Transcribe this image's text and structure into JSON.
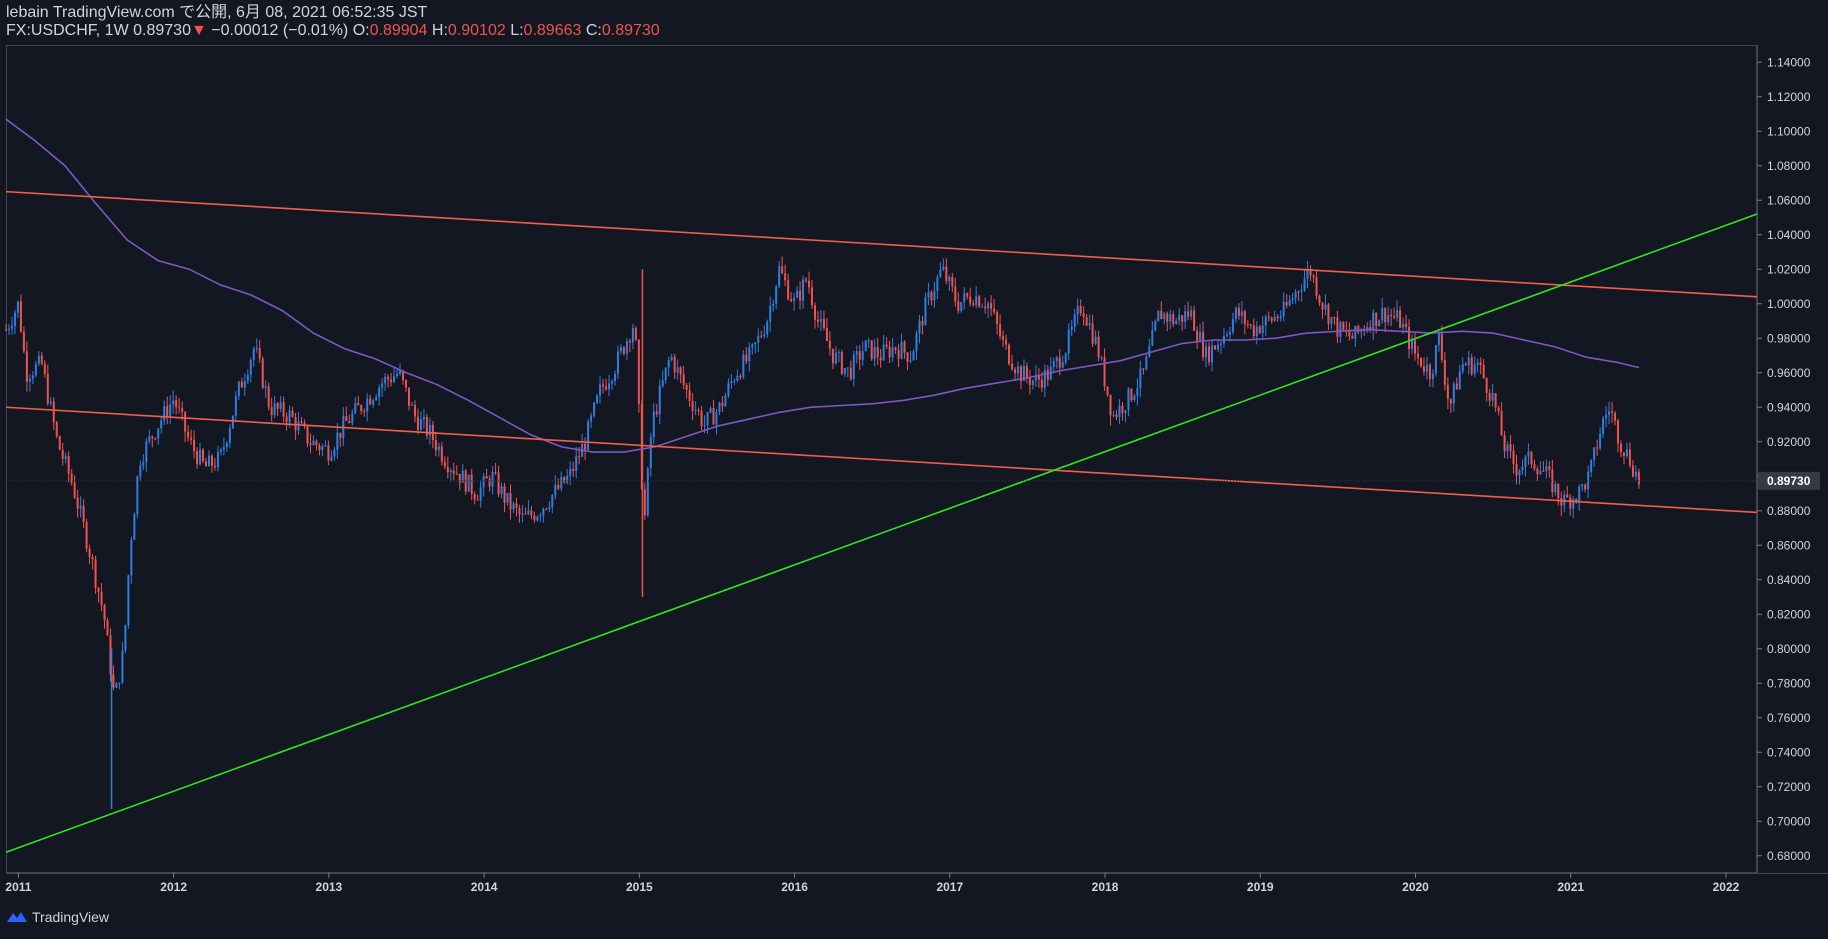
{
  "header": {
    "line1": "lebain TradingView.com で公開, 6月 08, 2021 06:52:35 JST",
    "symbol": "FX:USDCHF, 1W",
    "last": "0.89730",
    "arrow": "▼",
    "change": "−0.00012 (−0.01%)",
    "o_label": "O:",
    "o_value": "0.89904",
    "h_label": "H:",
    "h_value": "0.90102",
    "l_label": "L:",
    "l_value": "0.89663",
    "c_label": "C:",
    "c_value": "0.89730"
  },
  "footer": {
    "brand": "TradingView",
    "logo_icon": "tradingview-logo-icon"
  },
  "colors": {
    "background": "#131722",
    "up": "#2f7fe0",
    "down": "#ef5350",
    "trendline_red": "#f0604a",
    "trendline_green": "#2ee51e",
    "ma": "#7e57c2",
    "price_badge": "#363a45"
  },
  "chart_data": {
    "type": "candlestick",
    "symbol": "FX:USDCHF",
    "interval": "1W",
    "ylim": [
      0.67,
      1.15
    ],
    "xlim": [
      2010.92,
      2022.2
    ],
    "y_ticks": [
      "1.14000",
      "1.12000",
      "1.10000",
      "1.08000",
      "1.06000",
      "1.04000",
      "1.02000",
      "1.00000",
      "0.98000",
      "0.96000",
      "0.94000",
      "0.92000",
      "0.90000",
      "0.88000",
      "0.86000",
      "0.84000",
      "0.82000",
      "0.80000",
      "0.78000",
      "0.76000",
      "0.74000",
      "0.72000",
      "0.70000",
      "0.68000"
    ],
    "x_ticks": [
      "2011",
      "2012",
      "2013",
      "2014",
      "2015",
      "2016",
      "2017",
      "2018",
      "2019",
      "2020",
      "2021",
      "2022"
    ],
    "current_price": "0.89730",
    "close_path": [
      [
        2010.92,
        0.985
      ],
      [
        2011.0,
        1.0
      ],
      [
        2011.05,
        0.96
      ],
      [
        2011.15,
        0.965
      ],
      [
        2011.25,
        0.92
      ],
      [
        2011.35,
        0.895
      ],
      [
        2011.45,
        0.86
      ],
      [
        2011.55,
        0.82
      ],
      [
        2011.62,
        0.77
      ],
      [
        2011.68,
        0.8
      ],
      [
        2011.72,
        0.86
      ],
      [
        2011.78,
        0.91
      ],
      [
        2011.9,
        0.93
      ],
      [
        2012.0,
        0.945
      ],
      [
        2012.1,
        0.92
      ],
      [
        2012.2,
        0.905
      ],
      [
        2012.3,
        0.91
      ],
      [
        2012.42,
        0.95
      ],
      [
        2012.52,
        0.975
      ],
      [
        2012.62,
        0.94
      ],
      [
        2012.75,
        0.935
      ],
      [
        2012.88,
        0.92
      ],
      [
        2013.0,
        0.915
      ],
      [
        2013.1,
        0.93
      ],
      [
        2013.2,
        0.94
      ],
      [
        2013.35,
        0.955
      ],
      [
        2013.45,
        0.96
      ],
      [
        2013.55,
        0.935
      ],
      [
        2013.65,
        0.925
      ],
      [
        2013.75,
        0.91
      ],
      [
        2013.85,
        0.9
      ],
      [
        2013.95,
        0.89
      ],
      [
        2014.05,
        0.9
      ],
      [
        2014.15,
        0.885
      ],
      [
        2014.25,
        0.875
      ],
      [
        2014.35,
        0.88
      ],
      [
        2014.45,
        0.89
      ],
      [
        2014.55,
        0.9
      ],
      [
        2014.65,
        0.92
      ],
      [
        2014.75,
        0.95
      ],
      [
        2014.85,
        0.965
      ],
      [
        2014.97,
        0.99
      ],
      [
        2015.03,
        0.87
      ],
      [
        2015.08,
        0.93
      ],
      [
        2015.2,
        0.97
      ],
      [
        2015.3,
        0.95
      ],
      [
        2015.42,
        0.93
      ],
      [
        2015.52,
        0.94
      ],
      [
        2015.62,
        0.96
      ],
      [
        2015.72,
        0.97
      ],
      [
        2015.82,
        0.99
      ],
      [
        2015.9,
        1.02
      ],
      [
        2016.0,
        1.0
      ],
      [
        2016.08,
        1.015
      ],
      [
        2016.15,
        0.99
      ],
      [
        2016.25,
        0.97
      ],
      [
        2016.35,
        0.96
      ],
      [
        2016.45,
        0.975
      ],
      [
        2016.55,
        0.97
      ],
      [
        2016.65,
        0.975
      ],
      [
        2016.75,
        0.97
      ],
      [
        2016.85,
        1.0
      ],
      [
        2016.95,
        1.02
      ],
      [
        2017.05,
        1.0
      ],
      [
        2017.15,
        1.005
      ],
      [
        2017.25,
        1.0
      ],
      [
        2017.35,
        0.975
      ],
      [
        2017.45,
        0.96
      ],
      [
        2017.55,
        0.955
      ],
      [
        2017.65,
        0.96
      ],
      [
        2017.75,
        0.975
      ],
      [
        2017.85,
        1.0
      ],
      [
        2017.95,
        0.975
      ],
      [
        2018.05,
        0.935
      ],
      [
        2018.15,
        0.945
      ],
      [
        2018.25,
        0.96
      ],
      [
        2018.35,
        0.995
      ],
      [
        2018.45,
        0.99
      ],
      [
        2018.55,
        0.995
      ],
      [
        2018.65,
        0.97
      ],
      [
        2018.75,
        0.98
      ],
      [
        2018.85,
        0.995
      ],
      [
        2018.95,
        0.985
      ],
      [
        2019.05,
        0.99
      ],
      [
        2019.15,
        0.995
      ],
      [
        2019.25,
        1.01
      ],
      [
        2019.32,
        1.02
      ],
      [
        2019.4,
        1.0
      ],
      [
        2019.5,
        0.985
      ],
      [
        2019.6,
        0.98
      ],
      [
        2019.7,
        0.99
      ],
      [
        2019.8,
        0.995
      ],
      [
        2019.9,
        0.99
      ],
      [
        2020.0,
        0.97
      ],
      [
        2020.1,
        0.96
      ],
      [
        2020.15,
        0.98
      ],
      [
        2020.22,
        0.94
      ],
      [
        2020.3,
        0.965
      ],
      [
        2020.4,
        0.965
      ],
      [
        2020.5,
        0.945
      ],
      [
        2020.58,
        0.915
      ],
      [
        2020.65,
        0.905
      ],
      [
        2020.75,
        0.91
      ],
      [
        2020.85,
        0.9
      ],
      [
        2020.95,
        0.885
      ],
      [
        2021.05,
        0.89
      ],
      [
        2021.12,
        0.9
      ],
      [
        2021.2,
        0.93
      ],
      [
        2021.25,
        0.94
      ],
      [
        2021.32,
        0.92
      ],
      [
        2021.38,
        0.91
      ],
      [
        2021.44,
        0.897
      ]
    ],
    "ma_path": [
      [
        2010.92,
        1.107
      ],
      [
        2011.1,
        1.095
      ],
      [
        2011.3,
        1.08
      ],
      [
        2011.5,
        1.058
      ],
      [
        2011.7,
        1.037
      ],
      [
        2011.9,
        1.025
      ],
      [
        2012.1,
        1.02
      ],
      [
        2012.3,
        1.011
      ],
      [
        2012.5,
        1.005
      ],
      [
        2012.7,
        0.996
      ],
      [
        2012.9,
        0.983
      ],
      [
        2013.1,
        0.974
      ],
      [
        2013.3,
        0.968
      ],
      [
        2013.5,
        0.96
      ],
      [
        2013.7,
        0.953
      ],
      [
        2013.9,
        0.944
      ],
      [
        2014.1,
        0.934
      ],
      [
        2014.3,
        0.924
      ],
      [
        2014.5,
        0.917
      ],
      [
        2014.7,
        0.914
      ],
      [
        2014.9,
        0.914
      ],
      [
        2015.1,
        0.917
      ],
      [
        2015.3,
        0.923
      ],
      [
        2015.5,
        0.929
      ],
      [
        2015.7,
        0.933
      ],
      [
        2015.9,
        0.937
      ],
      [
        2016.1,
        0.94
      ],
      [
        2016.3,
        0.941
      ],
      [
        2016.5,
        0.942
      ],
      [
        2016.7,
        0.944
      ],
      [
        2016.9,
        0.947
      ],
      [
        2017.1,
        0.951
      ],
      [
        2017.3,
        0.954
      ],
      [
        2017.5,
        0.957
      ],
      [
        2017.7,
        0.961
      ],
      [
        2017.9,
        0.964
      ],
      [
        2018.1,
        0.967
      ],
      [
        2018.3,
        0.972
      ],
      [
        2018.5,
        0.977
      ],
      [
        2018.7,
        0.979
      ],
      [
        2018.9,
        0.979
      ],
      [
        2019.1,
        0.98
      ],
      [
        2019.3,
        0.983
      ],
      [
        2019.5,
        0.984
      ],
      [
        2019.7,
        0.985
      ],
      [
        2019.9,
        0.984
      ],
      [
        2020.1,
        0.983
      ],
      [
        2020.3,
        0.984
      ],
      [
        2020.5,
        0.983
      ],
      [
        2020.7,
        0.979
      ],
      [
        2020.9,
        0.975
      ],
      [
        2021.1,
        0.969
      ],
      [
        2021.3,
        0.966
      ],
      [
        2021.44,
        0.963
      ]
    ],
    "trendlines": [
      {
        "color": "red",
        "points": [
          [
            2010.92,
            1.065
          ],
          [
            2022.2,
            1.004
          ]
        ]
      },
      {
        "color": "red",
        "points": [
          [
            2010.92,
            0.94
          ],
          [
            2022.2,
            0.879
          ]
        ]
      },
      {
        "color": "green",
        "points": [
          [
            2010.92,
            0.682
          ],
          [
            2022.2,
            1.052
          ]
        ]
      }
    ]
  }
}
